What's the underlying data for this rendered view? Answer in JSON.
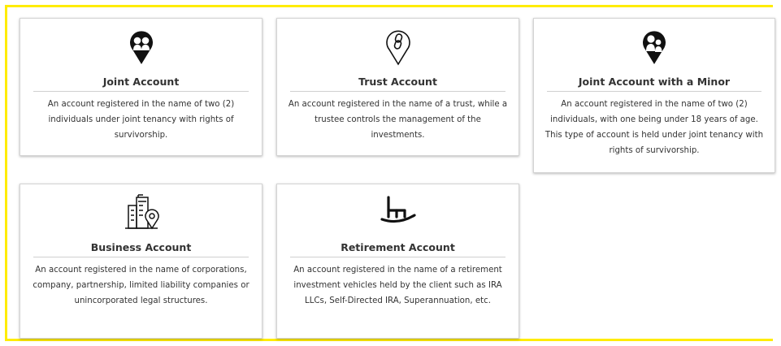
{
  "accounts": [
    {
      "icon": "joint-people-pin-icon",
      "title": "Joint Account",
      "description": "An account registered in the name of two (2) individuals under joint tenancy with rights of survivorship."
    },
    {
      "icon": "chain-link-pin-icon",
      "title": "Trust Account",
      "description": "An account registered in the name of a trust, while a trustee controls the management of the investments."
    },
    {
      "icon": "parent-child-pin-icon",
      "title": "Joint Account with a Minor",
      "description": "An account registered in the name of two (2) individuals, with one being under 18 years of age. This type of account is held under joint tenancy with rights of survivorship."
    },
    {
      "icon": "buildings-location-icon",
      "title": "Business Account",
      "description": "An account registered in the name of corporations, company, partnership, limited liability companies or unincorporated legal structures."
    },
    {
      "icon": "rocking-chair-icon",
      "title": "Retirement Account",
      "description": "An account registered in the name of a retirement investment vehicles held by the client such as IRA LLCs, Self-Directed IRA, Superannuation, etc."
    }
  ],
  "colors": {
    "frame_border": "#ffec00",
    "text": "#333333",
    "icon": "#111111"
  }
}
